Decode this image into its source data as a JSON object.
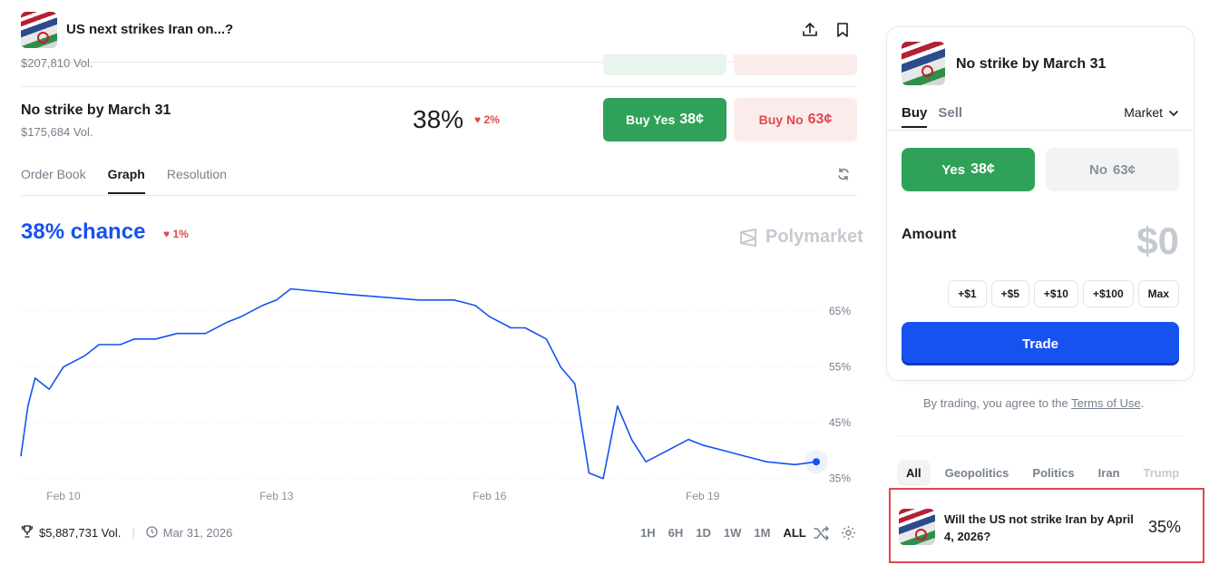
{
  "header": {
    "title": "US next strikes Iran on...?",
    "prev_volume": "$207,810 Vol."
  },
  "market": {
    "title": "No strike by March 31",
    "volume": "$175,684 Vol.",
    "percent": "38%",
    "change": "2%",
    "buy_yes_label": "Buy Yes",
    "buy_yes_price": "38¢",
    "buy_no_label": "Buy No",
    "buy_no_price": "63¢"
  },
  "tabs": [
    "Order Book",
    "Graph",
    "Resolution"
  ],
  "chance": {
    "text": "38% chance",
    "change": "1%",
    "brand": "Polymarket"
  },
  "chart_data": {
    "type": "line",
    "series": [
      {
        "color": "#1652f0",
        "x": [
          9.4,
          9.5,
          9.6,
          9.8,
          10.0,
          10.3,
          10.5,
          10.8,
          11.0,
          11.3,
          11.6,
          12.0,
          12.3,
          12.5,
          12.8,
          13.0,
          13.2,
          13.6,
          14.0,
          14.5,
          15.0,
          15.5,
          15.8,
          16.0,
          16.3,
          16.5,
          16.8,
          17.0,
          17.2,
          17.4,
          17.6,
          17.8,
          18.0,
          18.2,
          18.5,
          18.8,
          19.0,
          19.3,
          19.6,
          19.9,
          20.3,
          20.6
        ],
        "values": [
          39,
          48,
          53,
          51,
          55,
          57,
          59,
          59,
          60,
          60,
          61,
          61,
          63,
          64,
          66,
          67,
          69,
          68.5,
          68,
          67.5,
          67,
          67,
          66,
          64,
          62,
          62,
          60,
          55,
          52,
          36,
          35,
          48,
          42,
          38,
          40,
          42,
          41,
          40,
          39,
          38,
          37.5,
          38
        ]
      }
    ],
    "x_ticks": [
      "Feb 10",
      "Feb 13",
      "Feb 16",
      "Feb 19"
    ],
    "y_ticks": [
      "65%",
      "55%",
      "45%",
      "35%"
    ],
    "ylim": [
      33,
      72
    ],
    "grid": true
  },
  "footer": {
    "volume": "$5,887,731 Vol.",
    "date": "Mar 31, 2026",
    "ranges": [
      "1H",
      "6H",
      "1D",
      "1W",
      "1M",
      "ALL"
    ],
    "active_range": "ALL"
  },
  "panel": {
    "title": "No strike by March 31",
    "buy": "Buy",
    "sell": "Sell",
    "order_type": "Market",
    "yes_label": "Yes",
    "yes_price": "38¢",
    "no_label": "No",
    "no_price": "63¢",
    "amount_label": "Amount",
    "amount_value": "$0",
    "chips": [
      "+$1",
      "+$5",
      "+$10",
      "+$100",
      "Max"
    ],
    "trade": "Trade"
  },
  "terms": {
    "prefix": "By trading, you agree to the",
    "link": "Terms of Use",
    "suffix": "."
  },
  "categories": [
    "All",
    "Geopolitics",
    "Politics",
    "Iran",
    "Trump"
  ],
  "related": {
    "question": "Will the US not strike Iran by April 4, 2026?",
    "percent": "35%"
  }
}
